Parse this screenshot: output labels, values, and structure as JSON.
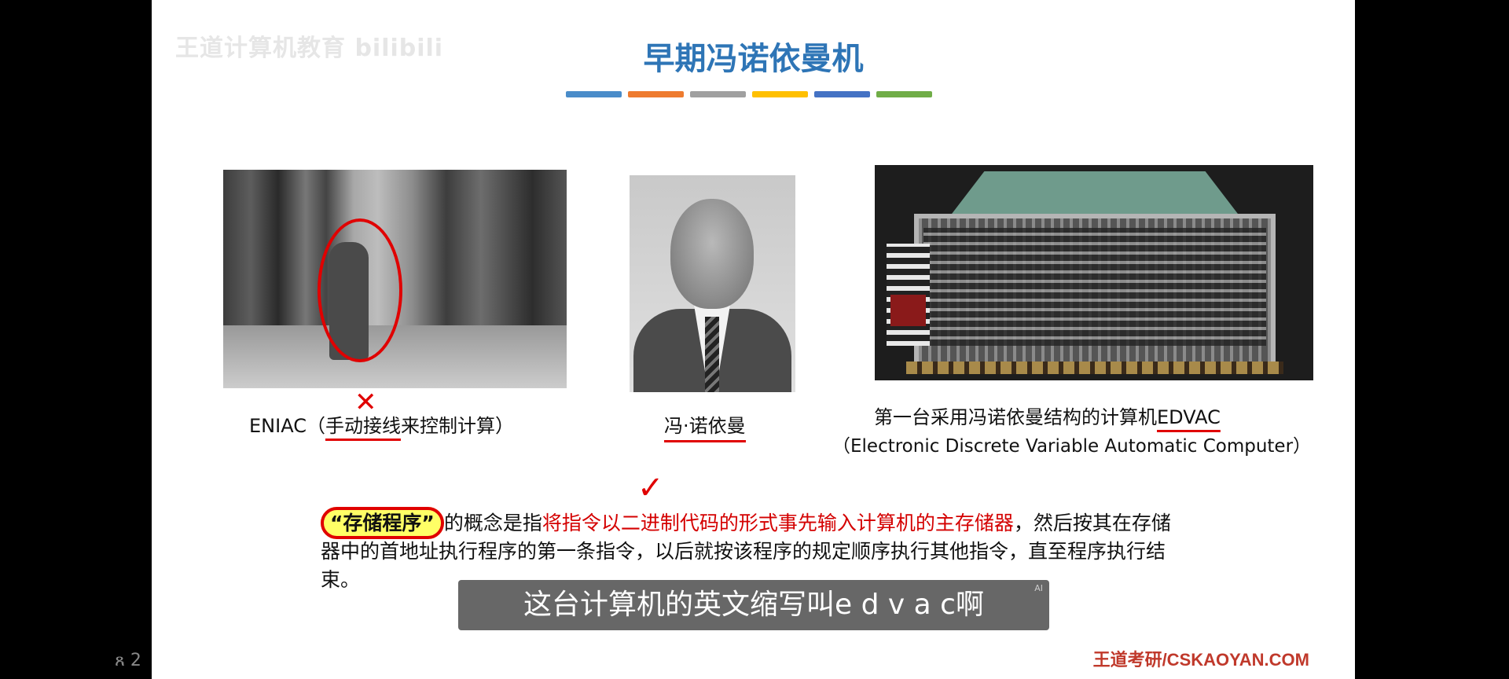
{
  "watermark": "王道计算机教育 bilibili",
  "slide": {
    "title": "早期冯诺依曼机",
    "bar_colors": [
      "#4a8cc9",
      "#ee7b2f",
      "#a0a0a0",
      "#ffc000",
      "#4472c4",
      "#70ad47"
    ]
  },
  "eniac": {
    "caption_prefix": "ENIAC（",
    "caption_underlined": "手动接线",
    "caption_suffix": "来控制计算）",
    "x_mark": "✕"
  },
  "vonneumann": {
    "caption": "冯·诺依曼"
  },
  "edvac": {
    "caption_line1_prefix": "第一台采用冯诺依曼结构的计算机",
    "caption_line1_name": "EDVAC",
    "caption_line2": "（Electronic Discrete Variable Automatic Computer）"
  },
  "paragraph": {
    "highlight": "“存储程序”",
    "part1": "的概念是指",
    "red_part": "将指令以二进制代码的形式事先输入计算机的主存储器",
    "part2": "，然后按其在存储器中的首地址执行程序的第一条指令，以后就按该程序的规定顺序执行其他指令，直至程序执行结束。",
    "check_mark": "✓"
  },
  "subtitle": {
    "text": "这台计算机的英文缩写叫e d v a c啊",
    "ai_tag": "AI"
  },
  "footer": {
    "brand": "王道考研/CSKAOYAN.COM"
  },
  "left_widget": "ጸ 2"
}
